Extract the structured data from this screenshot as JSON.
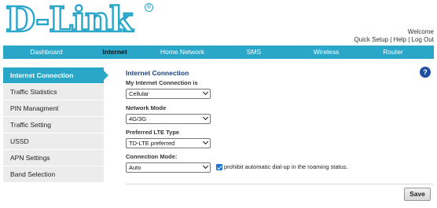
{
  "brand": {
    "logo_text": "D-Link",
    "registered_mark": "®"
  },
  "header": {
    "welcome": "Welcome",
    "links": [
      "Quick Setup",
      "Help",
      "Log Out"
    ],
    "separator": " | "
  },
  "nav": {
    "tabs": [
      "Dashboard",
      "Internet",
      "Home Network",
      "SMS",
      "Wireless",
      "Router"
    ],
    "active": "Internet"
  },
  "sidebar": {
    "items": [
      "Internet Connection",
      "Traffic Statistics",
      "PIN Managment",
      "Traffic Setting",
      "USSD",
      "APN Settings",
      "Band Selection"
    ],
    "active": "Internet Connection"
  },
  "content": {
    "title": "Internet Connection",
    "fields": [
      {
        "label": "My Internet Connection is",
        "value": "Cellular"
      },
      {
        "label": "Network Mode",
        "value": "4G/3G"
      },
      {
        "label": "Preferred LTE Type",
        "value": "TD-LTE preferred"
      },
      {
        "label": "Connection Mode:",
        "value": "Auto"
      }
    ],
    "roaming_checkbox": {
      "label": "prohibit automatic dial-up in the roaming status.",
      "checked": true
    }
  },
  "help_label": "?",
  "save_label": "Save",
  "colors": {
    "accent": "#2aa6c9",
    "title": "#1a3f78",
    "checkbox": "#1f73d6",
    "help": "#1f4fa3"
  }
}
